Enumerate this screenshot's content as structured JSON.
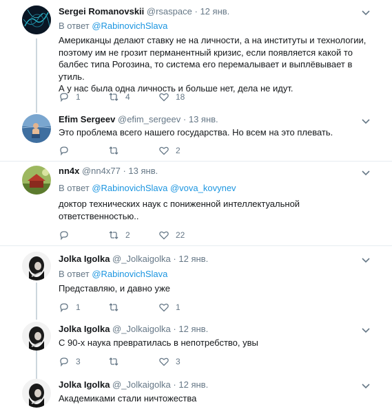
{
  "reply_prefix": "В ответ",
  "tweets": [
    {
      "name": "Sergei Romanovskii",
      "handle": "@rsaspace",
      "date": "12 янв.",
      "reply_to": [
        "@RabinovichSlava"
      ],
      "text_lines": [
        "Американцы делают ставку не на личности, а на институты и технологии,",
        "поэтому им не грозит перманентный кризис, если появляется какой то",
        "балбес типа Рогозина, то система его перемалывает и выплёвывает в утиль.",
        "А у нас была одна личность и больше нет, дела не идут."
      ],
      "replies": "1",
      "retweets": "4",
      "likes": "18"
    },
    {
      "name": "Efim Sergeev",
      "handle": "@efim_sergeev",
      "date": "13 янв.",
      "reply_to": [],
      "text_lines": [
        "Это проблема всего нашего государства. Но всем на это плевать."
      ],
      "replies": "",
      "retweets": "",
      "likes": "2"
    },
    {
      "name": "nn4x",
      "handle": "@nn4x77",
      "date": "13 янв.",
      "reply_to": [
        "@RabinovichSlava",
        "@vova_kovynev"
      ],
      "text_lines": [
        "доктор технических наук с пониженной интеллектуальной",
        "ответственностью.."
      ],
      "replies": "",
      "retweets": "2",
      "likes": "22"
    },
    {
      "name": "Jolka Igolka",
      "handle": "@_Jolkaigolka",
      "date": "12 янв.",
      "reply_to": [
        "@RabinovichSlava"
      ],
      "text_lines": [
        "Представляю, и давно уже"
      ],
      "replies": "1",
      "retweets": "",
      "likes": "1"
    },
    {
      "name": "Jolka Igolka",
      "handle": "@_Jolkaigolka",
      "date": "12 янв.",
      "reply_to": [],
      "text_lines": [
        "С 90-х наука превратилась в непотребство, увы"
      ],
      "replies": "3",
      "retweets": "",
      "likes": "3"
    },
    {
      "name": "Jolka Igolka",
      "handle": "@_Jolkaigolka",
      "date": "12 янв.",
      "reply_to": [],
      "text_lines": [
        "Академиками стали ничтожества"
      ],
      "replies": "",
      "retweets": "",
      "likes": ""
    }
  ]
}
